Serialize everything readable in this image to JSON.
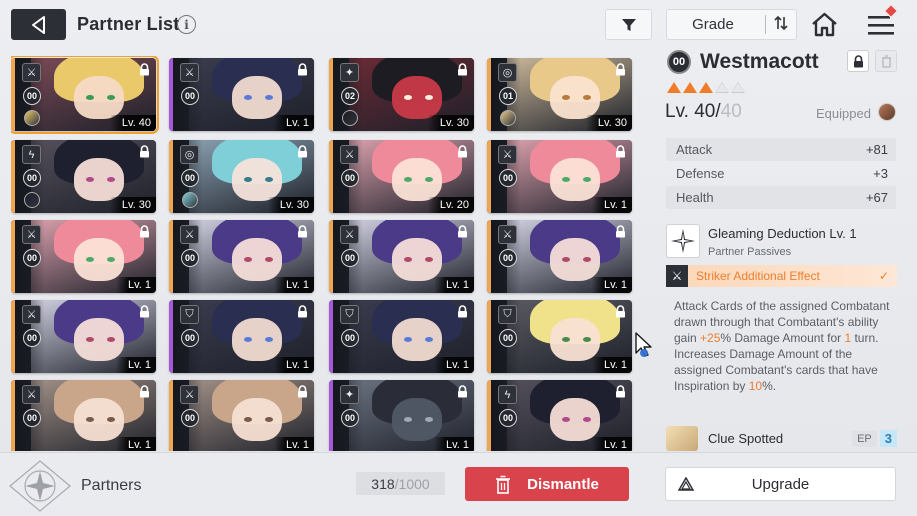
{
  "header": {
    "title": "Partner List",
    "info_icon": "i",
    "sort_label": "Grade",
    "icons": [
      "back-arrow-icon",
      "info-icon",
      "filter-icon",
      "sort-arrows-icon",
      "home-icon",
      "menu-icon"
    ]
  },
  "cards": [
    {
      "grade": "00",
      "level": "Lv. 40",
      "role": "striker",
      "stripe": "#f0a650",
      "locked": true,
      "selected": true,
      "hair": "#e9c96a",
      "skin": "#f6dbc6",
      "bg": "#7a4a55",
      "eye": "#3a9a5a",
      "equip": true
    },
    {
      "grade": "00",
      "level": "Lv. 1",
      "role": "striker",
      "stripe": "#a45ad8",
      "locked": true,
      "selected": false,
      "hair": "#2a2f52",
      "skin": "#f1dbd0",
      "bg": "#3a3c4e",
      "eye": "#5a7ad8",
      "equip": false
    },
    {
      "grade": "02",
      "level": "Lv. 30",
      "role": "support",
      "stripe": "#f0a650",
      "locked": true,
      "selected": false,
      "hair": "#1c1c22",
      "skin": "#c93a48",
      "bg": "#6a2a35",
      "eye": "#f7f0e0",
      "equip": true
    },
    {
      "grade": "01",
      "level": "Lv. 30",
      "role": "target",
      "stripe": "#f0a650",
      "locked": true,
      "selected": false,
      "hair": "#e8c98a",
      "skin": "#fae3cf",
      "bg": "#c9b79a",
      "eye": "#b87a3a",
      "equip": true
    },
    {
      "grade": "00",
      "level": "Lv. 30",
      "role": "breaker",
      "stripe": "#f0a650",
      "locked": true,
      "selected": false,
      "hair": "#1e2030",
      "skin": "#f4ddd5",
      "bg": "#54505c",
      "eye": "#b04a8a",
      "equip": true
    },
    {
      "grade": "00",
      "level": "Lv. 30",
      "role": "target",
      "stripe": "#f0a650",
      "locked": true,
      "selected": false,
      "hair": "#7fcfd8",
      "skin": "#f6e3db",
      "bg": "#8aa0b0",
      "eye": "#3b7a88",
      "equip": true
    },
    {
      "grade": "00",
      "level": "Lv. 20",
      "role": "striker",
      "stripe": "#f0a650",
      "locked": true,
      "selected": false,
      "hair": "#ee8a9a",
      "skin": "#fbe1d6",
      "bg": "#d9a0ac",
      "eye": "#4ea868",
      "equip": false
    },
    {
      "grade": "00",
      "level": "Lv. 1",
      "role": "striker",
      "stripe": "#f0a650",
      "locked": true,
      "selected": false,
      "hair": "#ee8a9a",
      "skin": "#fbe1d6",
      "bg": "#d9a0ac",
      "eye": "#4ea868",
      "equip": false
    },
    {
      "grade": "00",
      "level": "Lv. 1",
      "role": "striker",
      "stripe": "#f0a650",
      "locked": true,
      "selected": false,
      "hair": "#ee8a9a",
      "skin": "#fbe1d6",
      "bg": "#d9a0ac",
      "eye": "#4ea868",
      "equip": false
    },
    {
      "grade": "00",
      "level": "Lv. 1",
      "role": "striker",
      "stripe": "#f0a650",
      "locked": true,
      "selected": false,
      "hair": "#4a3a88",
      "skin": "#f4ddd8",
      "bg": "#cfcfe0",
      "eye": "#b04a6a",
      "equip": false
    },
    {
      "grade": "00",
      "level": "Lv. 1",
      "role": "striker",
      "stripe": "#f0a650",
      "locked": true,
      "selected": false,
      "hair": "#4a3a88",
      "skin": "#f4ddd8",
      "bg": "#cfcfe0",
      "eye": "#b04a6a",
      "equip": false
    },
    {
      "grade": "00",
      "level": "Lv. 1",
      "role": "striker",
      "stripe": "#f0a650",
      "locked": true,
      "selected": false,
      "hair": "#4a3a88",
      "skin": "#f4ddd8",
      "bg": "#cfcfe0",
      "eye": "#b04a6a",
      "equip": false
    },
    {
      "grade": "00",
      "level": "Lv. 1",
      "role": "striker",
      "stripe": "#f0a650",
      "locked": true,
      "selected": false,
      "hair": "#4a3a88",
      "skin": "#f4ddd8",
      "bg": "#cfcfe0",
      "eye": "#b04a6a",
      "equip": false
    },
    {
      "grade": "00",
      "level": "Lv. 1",
      "role": "defender",
      "stripe": "#a45ad8",
      "locked": true,
      "selected": false,
      "hair": "#2a2f52",
      "skin": "#f1dbd0",
      "bg": "#3a3c4e",
      "eye": "#5a7ad8",
      "equip": false
    },
    {
      "grade": "00",
      "level": "Lv. 1",
      "role": "defender",
      "stripe": "#a45ad8",
      "locked": true,
      "selected": false,
      "hair": "#2a2f52",
      "skin": "#f1dbd0",
      "bg": "#3a3c4e",
      "eye": "#5a7ad8",
      "equip": false
    },
    {
      "grade": "00",
      "level": "Lv. 1",
      "role": "defender",
      "stripe": "#f0a650",
      "locked": true,
      "selected": false,
      "hair": "#efe28a",
      "skin": "#f8e2d3",
      "bg": "#5a5a62",
      "eye": "#4a8a4a",
      "equip": false
    },
    {
      "grade": "00",
      "level": "Lv. 1",
      "role": "striker",
      "stripe": "#f0a650",
      "locked": true,
      "selected": false,
      "hair": "#c9a58a",
      "skin": "#f6dfd2",
      "bg": "#a08f86",
      "eye": "#7a5a4a",
      "equip": false
    },
    {
      "grade": "00",
      "level": "Lv. 1",
      "role": "striker",
      "stripe": "#f0a650",
      "locked": true,
      "selected": false,
      "hair": "#c9a58a",
      "skin": "#f6dfd2",
      "bg": "#a08f86",
      "eye": "#7a5a4a",
      "equip": false
    },
    {
      "grade": "00",
      "level": "Lv. 1",
      "role": "support",
      "stripe": "#a45ad8",
      "locked": true,
      "selected": false,
      "hair": "#2a2d38",
      "skin": "#505866",
      "bg": "#6a7280",
      "eye": "#a0a8b8",
      "equip": false
    },
    {
      "grade": "00",
      "level": "Lv. 1",
      "role": "breaker",
      "stripe": "#f0a650",
      "locked": true,
      "selected": false,
      "hair": "#1e2030",
      "skin": "#f4ddd5",
      "bg": "#54505c",
      "eye": "#b04a8a",
      "equip": false
    }
  ],
  "detail": {
    "grade": "00",
    "name": "Westmacott",
    "rating_filled": 3,
    "rating_total": 5,
    "level_prefix": "Lv. 40/",
    "level_max": "40",
    "equipped_label": "Equipped",
    "stats": [
      {
        "label": "Attack",
        "value": "+81"
      },
      {
        "label": "Defense",
        "value": "+3"
      },
      {
        "label": "Health",
        "value": "+67"
      }
    ],
    "passive_title": "Gleaming Deduction Lv. 1",
    "passive_sub": "Partner Passives",
    "effect_label": "Striker Additional Effect",
    "desc": {
      "p1": "Attack Cards of the assigned Combatant drawn through that Combatant's ability gain ",
      "v1": "+25",
      "p2": "% Damage Amount for ",
      "v2": "1",
      "p3": " turn. Increases Damage Amount of the assigned Combatant's cards that have Inspiration by ",
      "v3": "10",
      "p4": "%."
    },
    "clue_name": "Clue Spotted",
    "ep_label": "EP",
    "ep_value": "3"
  },
  "footer": {
    "partners_label": "Partners",
    "count_current": "318",
    "count_sep": " / ",
    "count_total": "1000",
    "dismantle_label": "Dismantle",
    "upgrade_label": "Upgrade"
  },
  "colors": {
    "accent_orange": "#ee7d2b",
    "dismantle_red": "#d9434b",
    "selected_outline": "#f3a02b"
  }
}
